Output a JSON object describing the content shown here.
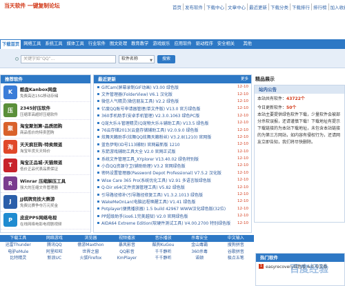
{
  "header": {
    "logo_text": "当天软件 一键复制论坛",
    "nav": [
      "首页",
      "发布软件",
      "下载中心",
      "文章中心",
      "最近更新",
      "下载分类",
      "下载排行",
      "排行榜",
      "加入收藏"
    ]
  },
  "mainnav": {
    "items": [
      "下载首页",
      "网络工具",
      "系统工具",
      "媒体工具",
      "行业软件",
      "图文处理",
      "教育教学",
      "游戏娱乐",
      "应用软件",
      "驱动程序",
      "安全相关",
      "其他"
    ]
  },
  "search": {
    "placeholder": "关键字如“QQ”...",
    "select_value": "软件名称",
    "button": "搜索"
  },
  "recommend": {
    "title": "推荐软件",
    "items": [
      {
        "title": "酷盘Kanbox网盘",
        "desc": "免费高达15G移动存储",
        "color": "#3b7dd8",
        "glyph": "K"
      },
      {
        "title": "2345好压软件",
        "desc": "压缩率高超好压缩软件",
        "color": "#5a8f3a",
        "glyph": "压"
      },
      {
        "title": "淘宝聚划算-品质团购",
        "desc": "商品低价的特卖团购",
        "color": "#d9622b",
        "glyph": "聚"
      },
      {
        "title": "天天疯狂购-特卖频道",
        "desc": "淘宝年货天天特价",
        "color": "#e0482a",
        "glyph": "淘"
      },
      {
        "title": "淘宝正品城-天猫频道",
        "desc": "低价正品代表品质保证",
        "color": "#c8232b",
        "glyph": "T"
      },
      {
        "title": "Winrar 压缩解压工具",
        "desc": "强大的压缩文件管理器",
        "color": "#7a3d8f",
        "glyph": "R"
      },
      {
        "title": "JJ棋牌竞技大赛游",
        "desc": "免费比赛争夺万元奖金",
        "color": "#2b5faa",
        "glyph": "J"
      },
      {
        "title": "皮皮PPS网络电视",
        "desc": "在线网络电影电视剧视频",
        "color": "#1f8bd0",
        "glyph": "P"
      }
    ]
  },
  "latest": {
    "title": "最近更新",
    "more": "更多",
    "items": [
      {
        "title": "GifCam(屏幕录制GIF动画) V3.00 绿色版",
        "date": "12-10"
      },
      {
        "title": "文件管理器(FolderView) V6.1 汉化版",
        "date": "12-10"
      },
      {
        "title": "微信人气精灵(微信朋友工具) V2.2 绿色版",
        "date": "12-10"
      },
      {
        "title": "亿度QQ账号申请器管理(单文件版) V13.0 官方绿色版",
        "date": "12-10"
      },
      {
        "title": "360手机助手(安卓手机管理) V2.3.0.1063 绿色PC版",
        "date": "12-10"
      },
      {
        "title": "Q宠大乐斗管理精灵(Q宠物大乐斗辅助工具) V13.5 绿色版",
        "date": "12-10"
      },
      {
        "title": "76云存储2013(云盘存储辅助工具) V2.0.9.0 绿色版",
        "date": "12-10"
      },
      {
        "title": "炫舞天籁助手(炫舞QQ炫舞天籁粉丝) V3.2.8(1210) 官网版",
        "date": "12-10"
      },
      {
        "title": "蓝色伊甸(ID号113辅助) 官网最新版 1210",
        "date": "12-10"
      },
      {
        "title": "东箭游戏辅助工具大全 V2.0 官网正式版",
        "date": "12-10"
      },
      {
        "title": "系统文件管理工具_XYplorer V13.40.02 绿色特别版",
        "date": "12-10"
      },
      {
        "title": "小白QQ资源守卫(辅助助理) V3.2 官网绿色版",
        "date": "12-10"
      },
      {
        "title": "密码设置管理器(Password Depot Professional) V7.5.2 汉化版",
        "date": "12-10"
      },
      {
        "title": "Wise Care 365 Pro(系统优化工具) V2.91 多语言版绿色版",
        "date": "12-10"
      },
      {
        "title": "Q-Dir x64(文件资源管理工具) V5.82 绿色版",
        "date": "12-10"
      },
      {
        "title": "引导路径修补(引导路径修复工具) V1.3.2.1013 绿色版",
        "date": "12-10"
      },
      {
        "title": "WakeMeOnLan(电脑远程唤醒工具) V1.41 绿色版",
        "date": "12-10"
      },
      {
        "title": "Potplayer(便携播放器) 1.5 build 42967 WWW汉化绿色版(32位)",
        "date": "12-10"
      },
      {
        "title": "PP超级助手(ios6.1完美越狱) V2.0 官网绿色版",
        "date": "12-10"
      },
      {
        "title": "AIDA64 Extreme Edition(软硬件测试工具) V4.00.2700 特别绿色版",
        "date": "12-10"
      }
    ]
  },
  "right": {
    "title": "精品展示",
    "box_title": "站内公告",
    "stats": [
      {
        "label": "本站共有软件：",
        "value": "43722个"
      },
      {
        "label": "今日更新软件：",
        "value": "50个"
      }
    ],
    "notice": "本站主要提供绿色软件下载，少量软件会被部分杀软误报，还请谨慎下载！下载地址有提示下载链接的为本站下载地址，未包含本站链接的为第三方网站，如内容有侵权行为，还请网友立即告知，我们将尽快删除。"
  },
  "bottom": {
    "heads": [
      "下载工具",
      "网络游戏",
      "浏览器",
      "视频播放",
      "音乐播放",
      "杀毒安全",
      "中文输入"
    ],
    "cells": [
      "迅雷Thunder",
      "腾讯QQ",
      "傲游Maxthon",
      "暴风影音",
      "酷狗KuGou",
      "金山毒霸",
      "搜狗拼音",
      "电驴eMule",
      "阿里旺旺",
      "世界之窗",
      "QQ影音",
      "千千静听",
      "360杀毒",
      "谷歌拼音",
      "比特精灵",
      "新浪UC",
      "火狐Firefox",
      "KmPlayer",
      "千千静听",
      "诺顿",
      "极点五笔"
    ]
  },
  "hot": {
    "title": "热门软件",
    "items": [
      {
        "num": "1",
        "title": "easyrecovery绿色版 6.0 中文版"
      }
    ]
  },
  "watermark": "百度经验"
}
